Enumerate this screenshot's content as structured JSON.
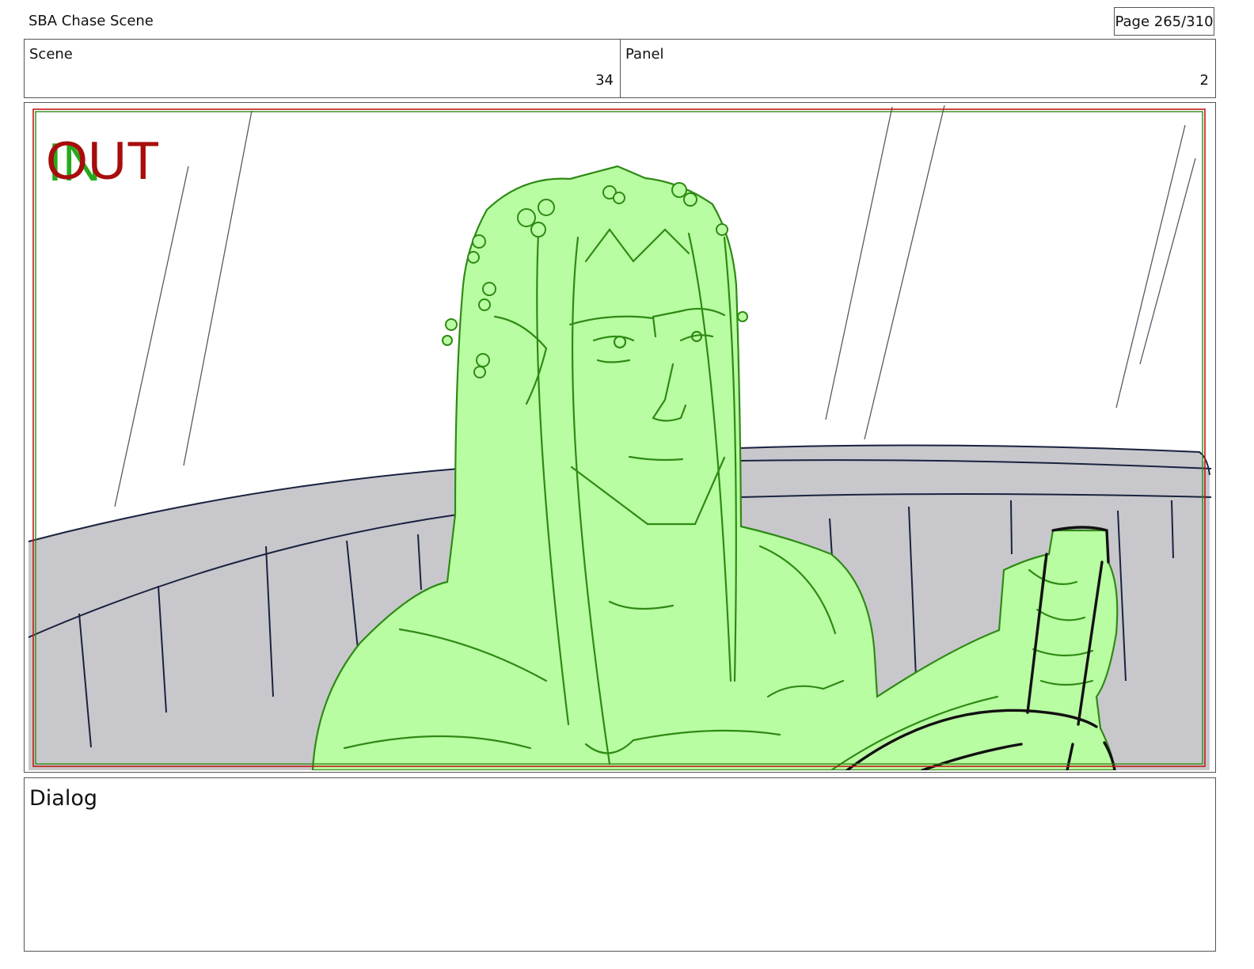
{
  "header": {
    "title": "SBA Chase Scene",
    "page": "Page 265/310"
  },
  "info": {
    "scene_label": "Scene",
    "scene_value": "34",
    "panel_label": "Panel",
    "panel_value": "2"
  },
  "panel": {
    "in_mark": "IN",
    "out_mark": "OUT"
  },
  "dialog": {
    "label": "Dialog"
  },
  "colors": {
    "character_fill": "#b9fda2",
    "character_line": "#2e8a14",
    "seat_fill": "#c8c8cc",
    "seat_line": "#1a2240",
    "frame_red": "#c21a1a",
    "frame_green": "#2e8a14"
  }
}
